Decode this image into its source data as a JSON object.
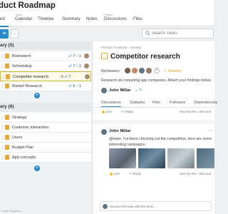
{
  "header": {
    "title": "duct Roadmap",
    "tabs": [
      {
        "group": "",
        "label": "ard"
      },
      {
        "group": "Tasks",
        "label": "Calendar"
      },
      {
        "group": "",
        "label": "Timeline"
      },
      {
        "group": "",
        "label": "Summary"
      },
      {
        "group": "",
        "label": "Notes"
      },
      {
        "group": "Project",
        "label": "Discussions"
      },
      {
        "group": "",
        "label": "Files"
      }
    ],
    "active_tab": 0
  },
  "toolbar": {
    "add_label": "sk",
    "search_placeholder": "Search Tasks"
  },
  "sections": [
    {
      "title": "uary (5)"
    },
    {
      "title": "uary (6)"
    }
  ],
  "tasks": [
    {
      "name": "Brainstorm",
      "icon_color": "#e8a93a",
      "comments": "",
      "subtasks": "7",
      "done": "1",
      "avatar": true
    },
    {
      "name": "Scheduling",
      "icon_color": "#e8a93a",
      "comments": "",
      "subtasks": "7",
      "done": "1",
      "avatar": true
    },
    {
      "name": "Competitor research",
      "icon_color": "#e8a93a",
      "comments": "6",
      "subtasks": "7",
      "done": "",
      "avatar": true,
      "selected": true
    },
    {
      "name": "Market Research",
      "icon_color": "#e8a93a",
      "comments": "",
      "subtasks": "5",
      "done": "1",
      "avatar": false
    },
    {
      "name": "Strategy",
      "icon_color": "#e8a93a",
      "comments": "",
      "subtasks": "",
      "done": "",
      "avatar": false
    },
    {
      "name": "Customer Interaction",
      "icon_color": "#e8a93a",
      "comments": "",
      "subtasks": "",
      "done": "",
      "avatar": false
    },
    {
      "name": "Users",
      "icon_color": "#e8a93a",
      "comments": "",
      "subtasks": "",
      "done": "",
      "avatar": false
    },
    {
      "name": "Budget Plan",
      "icon_color": "#e8a93a",
      "comments": "",
      "subtasks": "",
      "done": "",
      "avatar": false
    },
    {
      "name": "App concepts",
      "icon_color": "#e8a93a",
      "comments": "",
      "subtasks": "",
      "done": "",
      "avatar": false
    }
  ],
  "detail": {
    "breadcrumb": "Product Roadmap › January",
    "title": "Competitor research",
    "reviewers_label": "Reviewers:",
    "review_label": "Review",
    "description": "Research all competing app companies. Attach your findings below.",
    "assignee": "John Millar",
    "assignee_chevron": "⌄",
    "edit_label": "✎",
    "tabs": [
      "Discussions",
      "Subtasks",
      "Files",
      "Followers",
      "Dependencies"
    ],
    "active_tab": 0,
    "actions": {
      "like": "Like",
      "reply": "Reply",
      "seen": "Seen by Alex, John and"
    },
    "post": {
      "author": "John Millar",
      "more": "⋯",
      "body": "@team. I've been checking out the competition, here are some interesting campaigns.",
      "like": "Like",
      "reply": "Reply",
      "seen": "Seen by Alex, John and"
    },
    "comment_placeholder": "Discuss this task with the team ..."
  },
  "footer": {
    "text": "Lewis Graphics"
  },
  "colors": {
    "accent": "#2a89c8",
    "highlight": "#e3b63b",
    "review": "#e09b1a"
  }
}
